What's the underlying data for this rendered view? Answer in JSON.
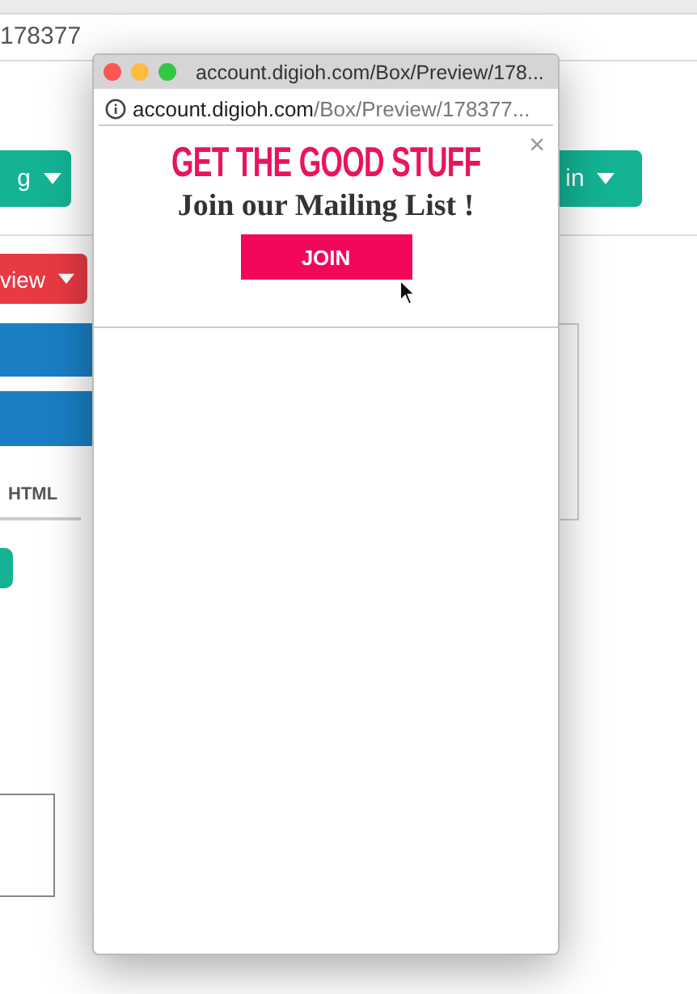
{
  "browser": {
    "address": "178377"
  },
  "background_page": {
    "left_button": {
      "label": "g"
    },
    "right_button": {
      "label": "in"
    },
    "red_button": {
      "label": "view"
    },
    "tab": {
      "label": "HTML"
    }
  },
  "popup_window": {
    "title": "account.digioh.com/Box/Preview/178...",
    "url_host": "account.digioh.com",
    "url_path": "/Box/Preview/178377...",
    "close": "×",
    "headline": "GET THE GOOD STUFF",
    "subheading": "Join our Mailing List !",
    "button": "JOIN"
  }
}
